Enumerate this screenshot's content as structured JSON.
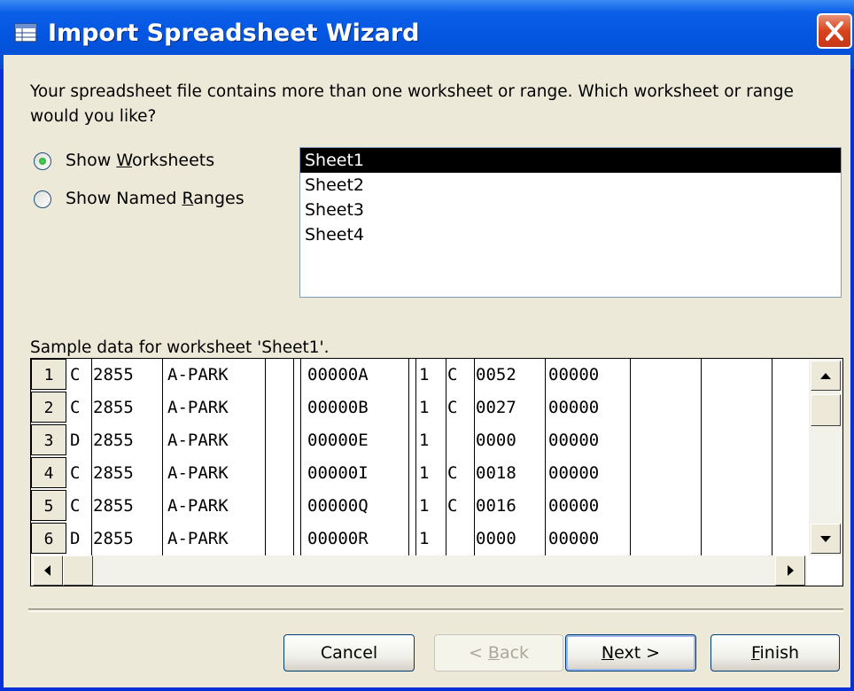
{
  "window": {
    "title": "Import Spreadsheet Wizard"
  },
  "prompt": "Your spreadsheet file contains more than one worksheet or range. Which worksheet or range would you like?",
  "radios": [
    {
      "pre": "Show ",
      "accel": "W",
      "post": "orksheets",
      "selected": true
    },
    {
      "pre": "Show Named ",
      "accel": "R",
      "post": "anges",
      "selected": false
    }
  ],
  "sheets": [
    "Sheet1",
    "Sheet2",
    "Sheet3",
    "Sheet4"
  ],
  "selected_sheet": "Sheet1",
  "sample_caption": "Sample data for worksheet 'Sheet1'.",
  "grid": {
    "rows": [
      {
        "n": "1",
        "cells": [
          "C",
          "2855",
          "A-PARK",
          "00000A",
          "1",
          "C",
          "0052",
          "00000"
        ]
      },
      {
        "n": "2",
        "cells": [
          "C",
          "2855",
          "A-PARK",
          "00000B",
          "1",
          "C",
          "0027",
          "00000"
        ]
      },
      {
        "n": "3",
        "cells": [
          "D",
          "2855",
          "A-PARK",
          "00000E",
          "1",
          "",
          "0000",
          "00000"
        ]
      },
      {
        "n": "4",
        "cells": [
          "C",
          "2855",
          "A-PARK",
          "00000I",
          "1",
          "C",
          "0018",
          "00000"
        ]
      },
      {
        "n": "5",
        "cells": [
          "C",
          "2855",
          "A-PARK",
          "00000Q",
          "1",
          "C",
          "0016",
          "00000"
        ]
      },
      {
        "n": "6",
        "cells": [
          "D",
          "2855",
          "A-PARK",
          "00000R",
          "1",
          "",
          "0000",
          "00000"
        ]
      }
    ]
  },
  "buttons": {
    "cancel": "Cancel",
    "back": {
      "pre": "< ",
      "accel": "B",
      "post": "ack"
    },
    "next": {
      "pre": "",
      "accel": "N",
      "post": "ext >"
    },
    "finish": {
      "pre": "",
      "accel": "F",
      "post": "inish"
    }
  },
  "icons": {
    "title_icon": "table-icon",
    "close": "close-icon",
    "scroll_up": "arrow-up-icon",
    "scroll_down": "arrow-down-icon",
    "scroll_left": "arrow-left-icon",
    "scroll_right": "arrow-right-icon"
  },
  "colors": {
    "title_bar": "#0455E0",
    "close_button": "#D9441C",
    "dialog_bg": "#ECE9D8",
    "selection": "#000000"
  }
}
